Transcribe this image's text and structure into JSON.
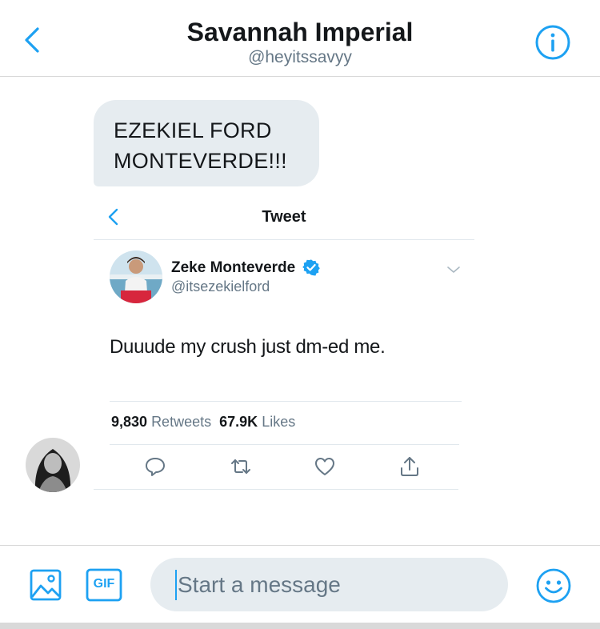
{
  "header": {
    "title": "Savannah Imperial",
    "handle": "@heyitssavyy",
    "back_icon": "chevron-left-icon",
    "info_icon": "info-icon"
  },
  "conversation": {
    "message_text": "EZEKIEL FORD\nMONTEVERDE!!!",
    "sender_avatar": "avatar"
  },
  "embedded_tweet": {
    "screen_title": "Tweet",
    "author_name": "Zeke Monteverde",
    "author_handle": "@itsezekielford",
    "verified": true,
    "text": "Duuude my crush just dm-ed me.",
    "retweets_count": "9,830",
    "retweets_label": "Retweets",
    "likes_count": "67.9K",
    "likes_label": "Likes",
    "actions": [
      "reply-icon",
      "retweet-icon",
      "like-icon",
      "share-icon"
    ]
  },
  "composer": {
    "placeholder": "Start a message",
    "value": "",
    "gif_label": "GIF",
    "image_icon": "image-icon",
    "emoji_icon": "emoji-icon"
  },
  "colors": {
    "accent": "#1da1f2",
    "bubble": "#e6ecf0",
    "secondary_text": "#657786"
  }
}
